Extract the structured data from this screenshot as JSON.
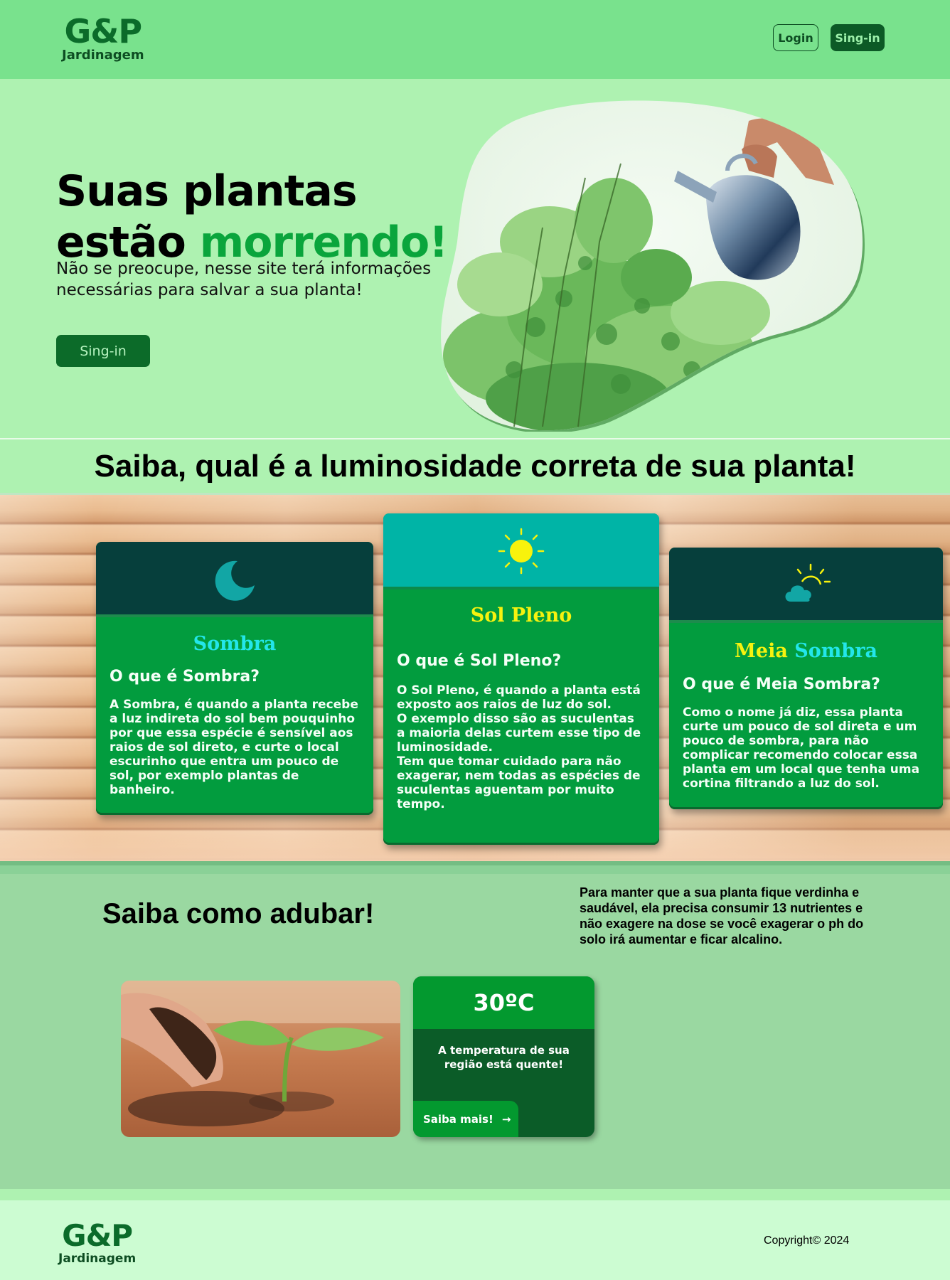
{
  "header": {
    "logo_mark": "G&P",
    "logo_sub": "Jardinagem",
    "login_label": "Login",
    "signin_label": "Sing-in"
  },
  "hero": {
    "title_line1": "Suas plantas",
    "title_word": "estão",
    "title_accent": "morrendo!",
    "description": "Não se preocupe, nesse site terá informações necessárias para salvar a sua planta!",
    "cta_label": "Sing-in"
  },
  "luminosity": {
    "title": "Saiba, qual é a luminosidade correta de sua planta!",
    "cards": [
      {
        "name": "Sombra",
        "icon": "moon-icon",
        "question": "O que é Sombra?",
        "body": "A Sombra, é quando a planta recebe a luz indireta do sol bem pouquinho por que essa espécie é sensível aos raios de sol direto, e curte o local escurinho que entra um pouco de sol, por exemplo plantas de banheiro."
      },
      {
        "name": "Sol Pleno",
        "icon": "sun-icon",
        "question": "O que é Sol Pleno?",
        "body1": "O Sol Pleno, é quando a planta está exposto aos raios de luz do sol.",
        "body2": "O exemplo disso são as suculentas a maioria delas curtem esse tipo de luminosidade.",
        "body3": "Tem que tomar cuidado para não exagerar, nem todas as espécies de suculentas aguentam por muito tempo."
      },
      {
        "name_part1": "Meia",
        "name_part2": "Sombra",
        "icon": "partly-cloudy-icon",
        "question": "O que é Meia Sombra?",
        "body": "Como o nome já diz, essa planta curte um pouco de sol direta e um pouco de sombra, para não complicar recomendo colocar essa planta em um local que tenha uma cortina filtrando a luz do sol."
      }
    ],
    "colors": {
      "cyan_title": "#23e6ea",
      "yellow_title": "#f6f20f",
      "card_green": "#029c3e"
    }
  },
  "adubar": {
    "title": "Saiba como adubar!",
    "info": "Para manter que a sua planta fique verdinha e saudável, ela precisa consumir 13 nutrientes e não exagere na dose se você exagerar o ph do solo irá aumentar e ficar alcalino.",
    "temperature": "30ºC",
    "temp_message": "A temperatura de sua região está quente!",
    "more_label": "Saiba mais!",
    "more_arrow": "→"
  },
  "footer": {
    "logo_mark": "G&P",
    "logo_sub": "Jardinagem",
    "copyright": "Copyright© 2024"
  }
}
